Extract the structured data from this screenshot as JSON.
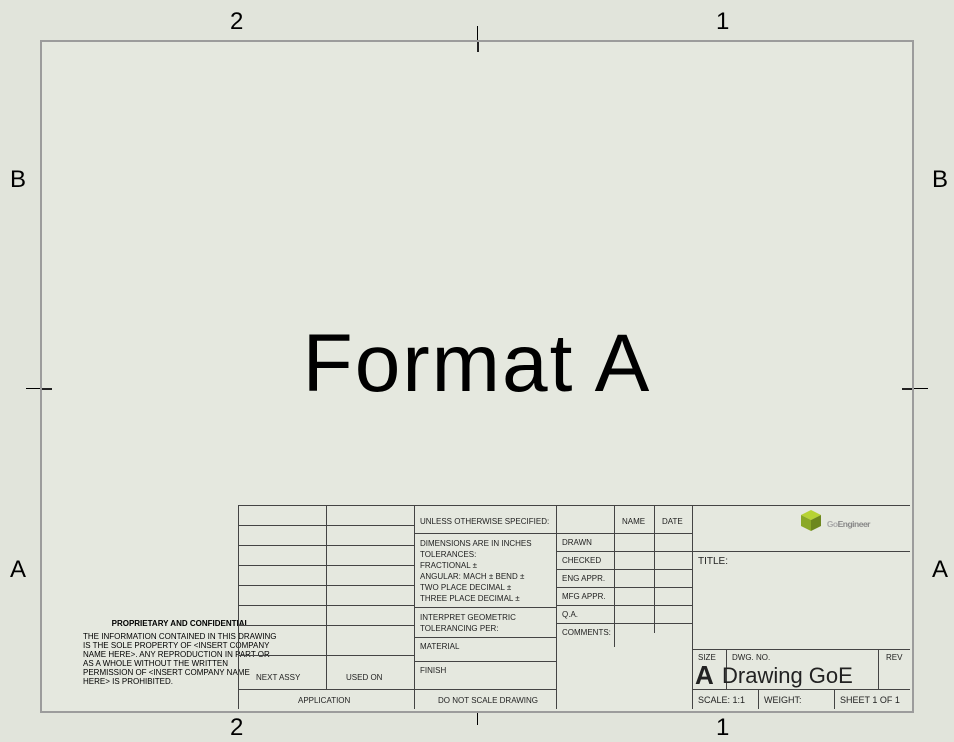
{
  "zones": {
    "top_left": "2",
    "top_right": "1",
    "bottom_left": "2",
    "bottom_right": "1",
    "left_top": "B",
    "left_bottom": "A",
    "right_top": "B",
    "right_bottom": "A"
  },
  "main_label": "Format A",
  "proprietary": {
    "heading": "PROPRIETARY AND CONFIDENTIAL",
    "body": "THE INFORMATION CONTAINED IN THIS DRAWING IS THE SOLE PROPERTY OF <INSERT COMPANY NAME HERE>. ANY REPRODUCTION IN PART OR AS A WHOLE WITHOUT THE WRITTEN PERMISSION OF <INSERT COMPANY NAME HERE> IS PROHIBITED."
  },
  "application": {
    "next_assy": "NEXT ASSY",
    "used_on": "USED ON",
    "label": "APPLICATION"
  },
  "tolerances": {
    "unless": "UNLESS OTHERWISE SPECIFIED:",
    "dims": "DIMENSIONS ARE IN INCHES",
    "tol": "TOLERANCES:",
    "frac": "FRACTIONAL ±",
    "ang": "ANGULAR: MACH ±    BEND ±",
    "two": "TWO PLACE DECIMAL    ±",
    "three": "THREE PLACE DECIMAL  ±",
    "geo1": "INTERPRET GEOMETRIC",
    "geo2": "TOLERANCING PER:",
    "material": "MATERIAL",
    "finish": "FINISH",
    "noscale": "DO NOT SCALE DRAWING"
  },
  "signoff": {
    "name": "NAME",
    "date": "DATE",
    "drawn": "DRAWN",
    "checked": "CHECKED",
    "eng": "ENG APPR.",
    "mfg": "MFG APPR.",
    "qa": "Q.A.",
    "comments": "COMMENTS:"
  },
  "title_area": {
    "title_label": "TITLE:",
    "size_label": "SIZE",
    "dwgno_label": "DWG.  NO.",
    "rev_label": "REV",
    "size_value": "A",
    "dwg_name": "Drawing GoE",
    "scale": "SCALE: 1:1",
    "weight": "WEIGHT:",
    "sheet": "SHEET 1 OF 1"
  },
  "logo": {
    "prefix": "Go",
    "suffix": "Engineer"
  }
}
